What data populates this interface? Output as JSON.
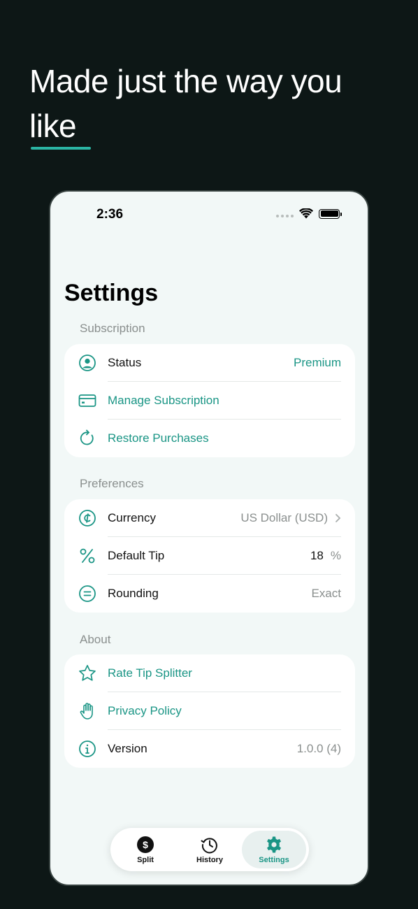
{
  "headline": {
    "line1": "Made just the way you",
    "line2": "like"
  },
  "status_bar": {
    "time": "2:36"
  },
  "page_title": "Settings",
  "sections": {
    "subscription": {
      "label": "Subscription",
      "status": {
        "label": "Status",
        "value": "Premium",
        "icon": "person-circle-icon"
      },
      "manage": {
        "label": "Manage Subscription",
        "icon": "credit-card-icon"
      },
      "restore": {
        "label": "Restore Purchases",
        "icon": "refresh-icon"
      }
    },
    "preferences": {
      "label": "Preferences",
      "currency": {
        "label": "Currency",
        "value": "US Dollar (USD)",
        "icon": "cent-icon"
      },
      "default_tip": {
        "label": "Default Tip",
        "value": "18",
        "unit": "%",
        "icon": "percent-icon"
      },
      "rounding": {
        "label": "Rounding",
        "value": "Exact",
        "icon": "equals-circle-icon"
      }
    },
    "about": {
      "label": "About",
      "rate": {
        "label": "Rate Tip Splitter",
        "icon": "star-icon"
      },
      "privacy": {
        "label": "Privacy Policy",
        "icon": "hand-icon"
      },
      "version": {
        "label": "Version",
        "value": "1.0.0 (4)",
        "icon": "info-icon"
      }
    }
  },
  "tabbar": {
    "split": "Split",
    "history": "History",
    "settings": "Settings",
    "active": "settings"
  },
  "colors": {
    "accent": "#1a9585",
    "background": "#0d1716",
    "underline": "#2bb5a4"
  }
}
